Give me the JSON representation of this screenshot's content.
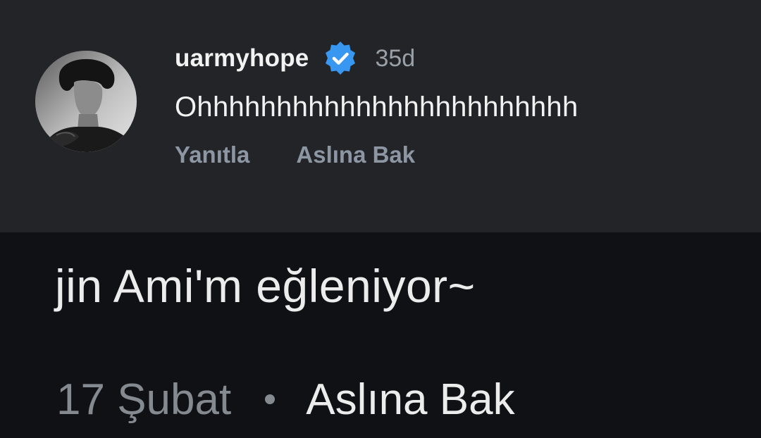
{
  "comment": {
    "username": "uarmyhope",
    "time": "35d",
    "text": "Ohhhhhhhhhhhhhhhhhhhhhhhh",
    "reply_label": "Yanıtla",
    "see_original_label": "Aslına Bak",
    "badge_color": "#3897f0"
  },
  "translation": {
    "title": "jin Ami'm eğleniyor~",
    "date": "17 Şubat",
    "see_original_label": "Aslına Bak"
  }
}
